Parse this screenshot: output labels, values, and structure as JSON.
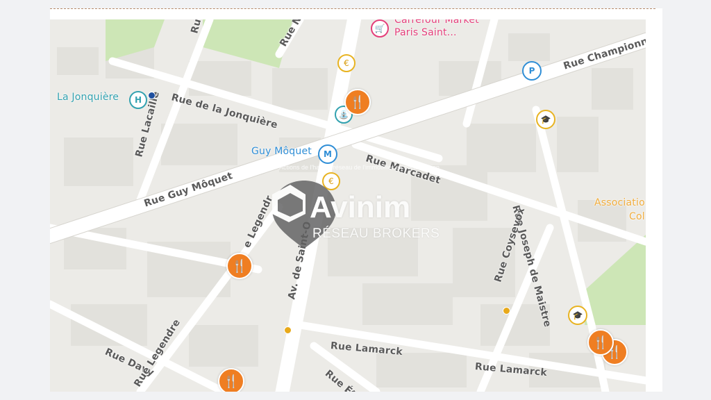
{
  "streets": {
    "rue_championnet": "Rue Championn",
    "rue_jonquiere": "Rue de la Jonquière",
    "rue_marcadet": "Rue Marcadet",
    "rue_guy_moquet": "Rue Guy Môquet",
    "rue_lacaille": "Rue Lacaille",
    "rue_legendre_upper": "e Legendr",
    "av_saint_ouen": "Av. de Saint-O",
    "rue_joseph_de_maistre": "Rue Joseph de Maistre",
    "rue_coysevox": "Rue Coysevox",
    "rue_lamarck_left": "Rue Lamarck",
    "rue_lamarck_right": "Rue Lamarck",
    "rue_davy": "Rue Davy",
    "rue_legendre_lower": "Rue Legendre",
    "rue_etex": "Rue Étex",
    "rue_top_left": "Ru",
    "rue_top_mid": "Rue N"
  },
  "places": {
    "carrefour_line1": "Carrefour Market",
    "carrefour_line2": "Paris Saint...",
    "la_jonquiere": "La Jonquière",
    "guy_moquet": "Guy Môquet",
    "association_line1": "Associatio",
    "association_line2": "Col"
  },
  "icons": {
    "restaurant": "🍴",
    "euro": "€",
    "parking": "P",
    "metro": "M",
    "hospital": "H",
    "school": "🎓",
    "cart": "🛒",
    "fountain": "⛲"
  },
  "watermark": {
    "brand": "Avinim",
    "subtitle": "RÉSEAU BROKERS",
    "tagline": "Actions de l'habitat réseau de l'immobilier en collaboration"
  },
  "colors": {
    "restaurant": "#ef7e22",
    "metro_blue": "#2f8ed6",
    "carrefour_pink": "#e43e7a",
    "park_green": "#cde6b6",
    "label_teal": "#33a2b0",
    "association_orange": "#f0ac3c"
  }
}
